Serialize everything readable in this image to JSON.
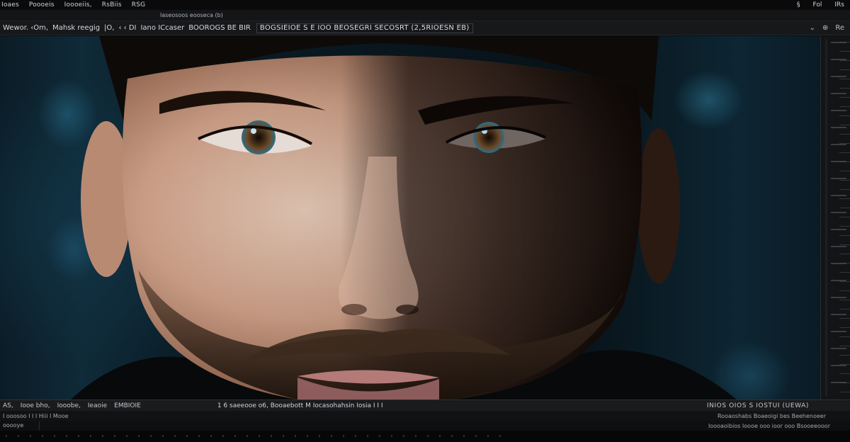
{
  "menubar": {
    "items": [
      "Ioaes",
      "Poooeis",
      "Ioooeiis,",
      "RsBiis",
      "RSG"
    ],
    "window_controls": [
      "§",
      "Fol",
      "IRs"
    ]
  },
  "titlebar": {
    "document_title": "Iaseosoos eooseca (b)"
  },
  "toolbar": {
    "left_items": [
      "Wewor. ‹Om,",
      "Mahsk reegig",
      "|O,",
      "‹ ‹ DI",
      "Iano ICcaser",
      "BOOROGS BE BIR"
    ],
    "breadcrumb": "BOGSIEIOE S E IOO BEOSEGRI SECOSRT (2,5RIOESN EB)",
    "right_icons": [
      "⌄",
      "⊕",
      "Re"
    ]
  },
  "statusbar": {
    "left_items": [
      "AS,",
      "Iooe bho,",
      "Iooobe,",
      "Ieaoie",
      "EMBIOIE"
    ],
    "mid_text": "1 6 saeeooe   o6,   Booaebott M Iocasohahsin   Iosia   I I I",
    "right_text": "INIOS OIOS S IOSTUI (UEWA)"
  },
  "layers": {
    "left": "I ooosoo   I   I   I   Hiii   I Mooe",
    "right": "Rooaoshabs   Boaeoigi bes  Beehenoeer"
  },
  "inputrow": {
    "field_value": "ooooye",
    "right_text": "Ioooaoibios Ioooe ooo ioor ooo  Bsooeeooor"
  },
  "canvas": {
    "content": "portrait-photo"
  }
}
